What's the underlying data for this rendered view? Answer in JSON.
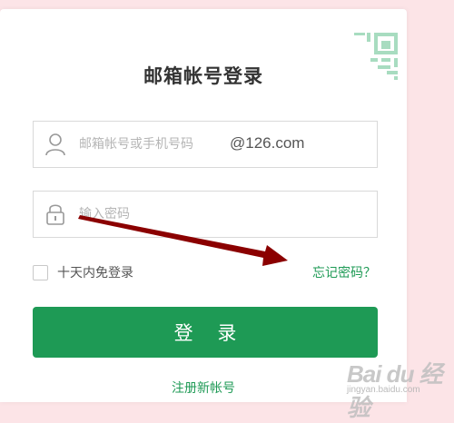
{
  "login_form": {
    "title": "邮箱帐号登录",
    "account": {
      "placeholder": "邮箱帐号或手机号码",
      "domain_suffix": "@126.com",
      "icon": "user-icon"
    },
    "password": {
      "placeholder": "输入密码",
      "icon": "lock-icon"
    },
    "remember_label": "十天内免登录",
    "forgot_link": "忘记密码？",
    "login_button": "登 录",
    "register_link": "注册新帐号",
    "qr_icon": "qr-code-icon"
  },
  "annotation": {
    "arrow_color": "#8b0000",
    "arrow_icon": "red-arrow-annotation"
  },
  "watermark": {
    "main": "Bai du 经验",
    "sub": "jingyan.baidu.com"
  },
  "colors": {
    "accent": "#1e9a55",
    "background": "#fce4e7"
  }
}
